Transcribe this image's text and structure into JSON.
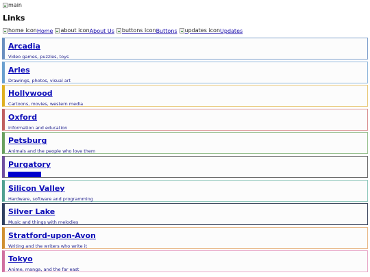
{
  "header": {
    "main_image_alt": "main",
    "title": "Links"
  },
  "nav": [
    {
      "icon_alt": "home icon",
      "label": "Home",
      "icon": "home-icon"
    },
    {
      "icon_alt": "about icon",
      "label": "About Us",
      "icon": "about-icon"
    },
    {
      "icon_alt": "buttons icon",
      "label": "Buttons",
      "icon": "buttons-icon"
    },
    {
      "icon_alt": "updates icon",
      "label": "Updates",
      "icon": "updates-icon"
    }
  ],
  "links": [
    {
      "name": "Arcadia",
      "desc": "Video games, puzzles, toys",
      "color": "#6a8fc0",
      "border": "#7fa0cc"
    },
    {
      "name": "Arles",
      "desc": "Drawings, photos, visual art",
      "color": "#6a9fcf",
      "border": "#8fb6da"
    },
    {
      "name": "Hollywood",
      "desc": "Cartoons, movies, western media",
      "color": "#e0b020",
      "border": "#e8c878"
    },
    {
      "name": "Oxford",
      "desc": "Information and education",
      "color": "#c06060",
      "border": "#d89090"
    },
    {
      "name": "Petsburg",
      "desc": "Animals and the people who love them",
      "color": "#6aa060",
      "border": "#98c090"
    },
    {
      "name": "Purgatory",
      "desc": "",
      "color": "#7050a0",
      "border": "#6c6c6c",
      "highlight": true
    },
    {
      "name": "Silicon Valley",
      "desc": "Hardware, software and programming",
      "color": "#50a090",
      "border": "#90c8bc"
    },
    {
      "name": "Silver Lake",
      "desc": "Music and things with melodies",
      "color": "#304060",
      "border": "#404a60"
    },
    {
      "name": "Stratford-upon-Avon",
      "desc": "Writing and the writers who write it",
      "color": "#d09030",
      "border": "#e8b888"
    },
    {
      "name": "Tokyo",
      "desc": "Anime, manga, and the far east",
      "color": "#d070a0",
      "border": "#e8a8c8"
    }
  ]
}
